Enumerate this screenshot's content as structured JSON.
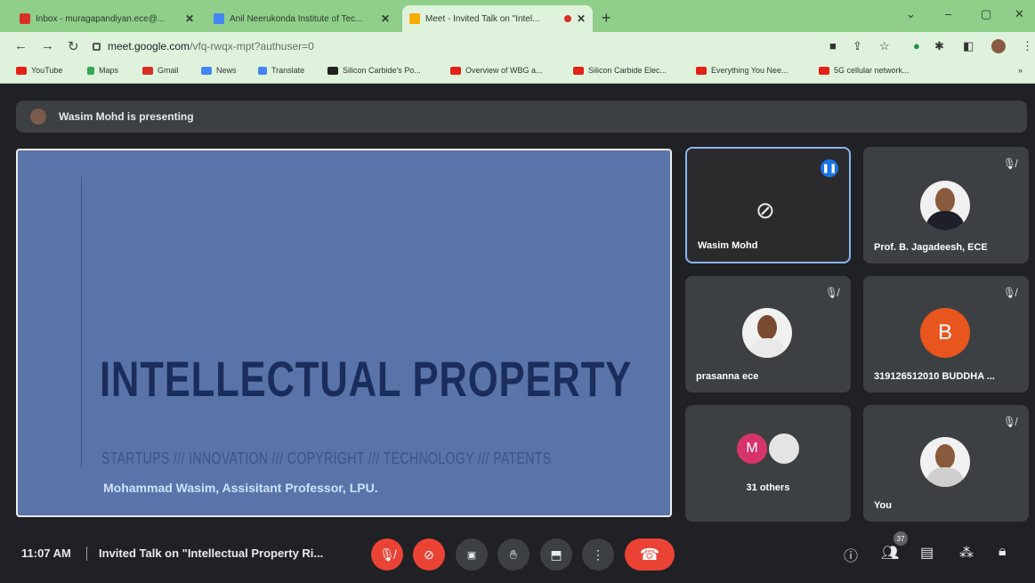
{
  "browser": {
    "tabs": [
      {
        "title": "Inbox - muragapandiyan.ece@...",
        "color": "#d93025"
      },
      {
        "title": "Anil Neerukonda Institute of Tec...",
        "color": "#4285f4"
      },
      {
        "title": "Meet - Invited Talk on \"Intel...",
        "color": "#f9ab00"
      }
    ],
    "new_tab": "+",
    "window_controls": {
      "minimize": "–",
      "maximize": "▢",
      "close": "✕"
    },
    "url_host": "meet.google.com",
    "url_path": "/vfq-rwqx-mpt?authuser=0",
    "bookmarks": [
      {
        "label": "YouTube",
        "color": "#e62117"
      },
      {
        "label": "Maps",
        "color": "#34a853"
      },
      {
        "label": "Gmail",
        "color": "#d93025"
      },
      {
        "label": "News",
        "color": "#4285f4"
      },
      {
        "label": "Translate",
        "color": "#4285f4"
      },
      {
        "label": "Silicon Carbide's Po...",
        "color": "#222222"
      },
      {
        "label": "Overview of WBG a...",
        "color": "#e62117"
      },
      {
        "label": "Silicon Carbide Elec...",
        "color": "#e62117"
      },
      {
        "label": "Everything You Nee...",
        "color": "#e62117"
      },
      {
        "label": "5G cellular network...",
        "color": "#e62117"
      }
    ]
  },
  "meet": {
    "presenting_text": "Wasim Mohd is presenting",
    "slide": {
      "title": "INTELLECTUAL PROPERTY",
      "subtitle": "STARTUPS /// INNOVATION /// COPYRIGHT /// TECHNOLOGY /// PATENTS",
      "author": "Mohammad Wasim, Assisitant Professor, LPU."
    },
    "participants": [
      {
        "name": "Wasim Mohd",
        "state": "speaking, camera off"
      },
      {
        "name": "Prof. B. Jagadeesh, ECE",
        "state": "muted"
      },
      {
        "name": "prasanna ece",
        "state": "muted"
      },
      {
        "name": "319126512010 BUDDHA ...",
        "state": "muted",
        "initial": "B"
      },
      {
        "name": "31 others",
        "initial": "M"
      },
      {
        "name": "You",
        "state": "muted"
      }
    ],
    "time": "11:07 AM",
    "meeting_title": "Invited Talk on \"Intellectual Property Ri...",
    "people_count": "37"
  }
}
